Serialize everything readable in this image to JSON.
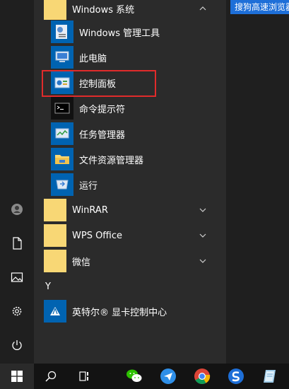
{
  "start_menu": {
    "group_windows_system": {
      "label": "Windows 系统"
    },
    "items": [
      {
        "label": "Windows 管理工具"
      },
      {
        "label": "此电脑"
      },
      {
        "label": "控制面板"
      },
      {
        "label": "命令提示符"
      },
      {
        "label": "任务管理器"
      },
      {
        "label": "文件资源管理器"
      },
      {
        "label": "运行"
      }
    ],
    "folders": [
      {
        "label": "WinRAR"
      },
      {
        "label": "WPS Office"
      },
      {
        "label": "微信"
      }
    ],
    "section_letter": "Y",
    "intel_item": {
      "label": "英特尔® 显卡控制中心"
    }
  },
  "tiles": {
    "sogou_label": "搜狗高速浏览器"
  },
  "colors": {
    "accent": "#0063b1",
    "highlight_box": "#e02b2b",
    "folder": "#f8d775"
  }
}
